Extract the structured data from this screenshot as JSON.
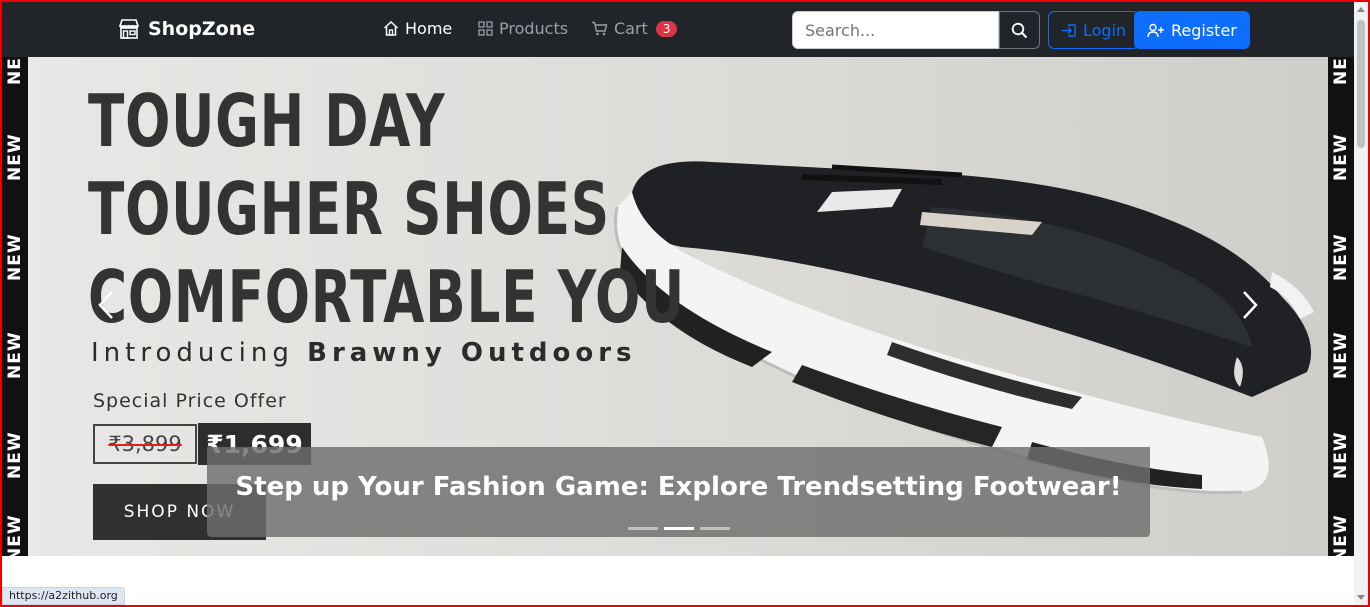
{
  "navbar": {
    "brand": "ShopZone",
    "brand_icon": "store-icon",
    "links": [
      {
        "label": "Home",
        "icon": "house-icon",
        "active": true
      },
      {
        "label": "Products",
        "icon": "grid-icon",
        "active": false
      },
      {
        "label": "Cart",
        "icon": "cart-icon",
        "active": false
      }
    ],
    "cart_count": "3",
    "search": {
      "placeholder": "Search..."
    },
    "login_label": "Login",
    "register_label": "Register",
    "colors": {
      "bg": "#212529",
      "primary": "#0d6efd",
      "badge": "#dc3545"
    }
  },
  "hero": {
    "side_text": "NEW",
    "headline": [
      "TOUGH DAY",
      "TOUGHER SHOES",
      "COMFORTABLE YOU"
    ],
    "intro_prefix": "Introducing ",
    "intro_brand": "Brawny Outdoors",
    "special_label": "Special Price Offer",
    "old_price": "₹3,899",
    "new_price": "₹1,699",
    "cta": "SHOP NOW",
    "caption": "Step up Your Fashion Game: Explore Trendsetting Footwear!",
    "slides_count": 3,
    "active_slide": 2
  },
  "status_url": "https://a2zithub.org"
}
